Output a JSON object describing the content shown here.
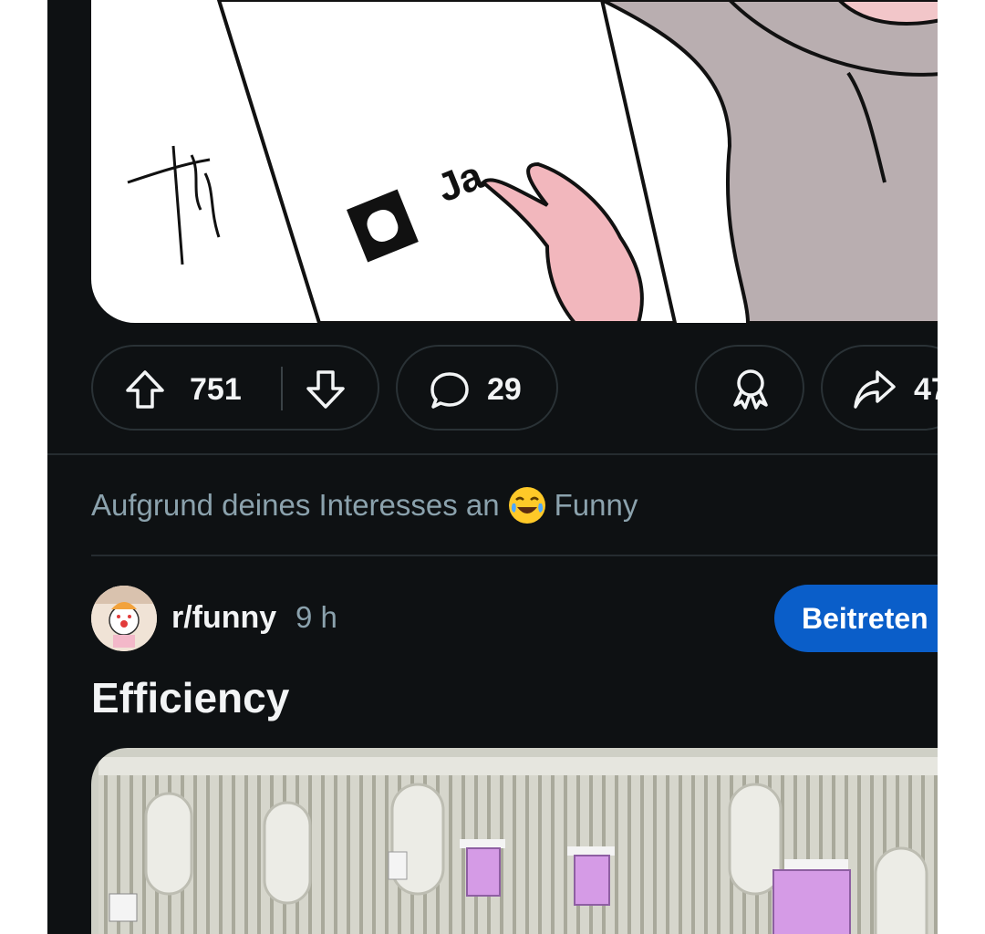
{
  "post1": {
    "image_text": "Ja",
    "upvotes": "751",
    "comments": "29",
    "shares": "47"
  },
  "recommendation": {
    "prefix": "Aufgrund deines Interesses an",
    "topic": "Funny"
  },
  "post2": {
    "subreddit": "r/funny",
    "age": "9 h",
    "join_label": "Beitreten",
    "title": "Efficiency"
  },
  "colors": {
    "background": "#0e1113",
    "primary_text": "#f2f4f5",
    "secondary_text": "#8ba2ad",
    "join_button": "#0a5ec9",
    "pill_border": "#2a3236"
  }
}
